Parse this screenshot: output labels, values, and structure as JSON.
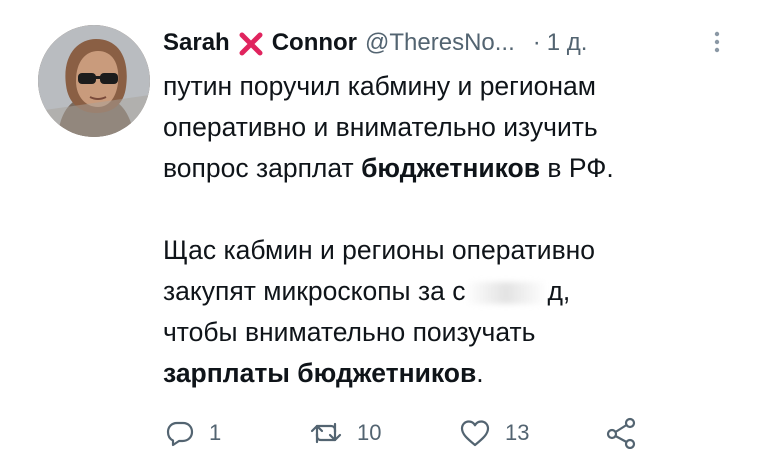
{
  "tweet": {
    "author": {
      "first_name": "Sarah",
      "last_name": "Connor",
      "handle": "@TheresNo...",
      "time": "1 д."
    },
    "lines": [
      {
        "parts": [
          {
            "text": "путин поручил кабмину и регионам",
            "bold": false
          }
        ]
      },
      {
        "parts": [
          {
            "text": "оперативно и внимательно изучить",
            "bold": false
          }
        ]
      },
      {
        "parts": [
          {
            "text": "вопрос зарплат ",
            "bold": false
          },
          {
            "text": "бюджетников",
            "bold": true
          },
          {
            "text": " в РФ.",
            "bold": false
          }
        ]
      },
      {
        "parts": [
          {
            "text": "Щас кабмин и регионы оперативно",
            "bold": false
          }
        ]
      },
      {
        "parts": [
          {
            "text": "закупят микроскопы за с",
            "bold": false
          },
          {
            "text": "д,",
            "bold": false
          }
        ]
      },
      {
        "parts": [
          {
            "text": "чтобы внимательно поизучать",
            "bold": false
          }
        ]
      },
      {
        "parts": [
          {
            "text": "зарплаты бюджетников",
            "bold": true
          },
          {
            "text": ".",
            "bold": false
          }
        ]
      }
    ],
    "actions": {
      "reply_count": "1",
      "retweet_count": "10",
      "like_count": "13"
    },
    "icons": [
      "cross-mark-icon",
      "more-icon",
      "reply-icon",
      "retweet-icon",
      "like-icon",
      "share-icon"
    ],
    "colors": {
      "text": "#0f1419",
      "secondary": "#536471",
      "cross": "#e0245e"
    }
  }
}
